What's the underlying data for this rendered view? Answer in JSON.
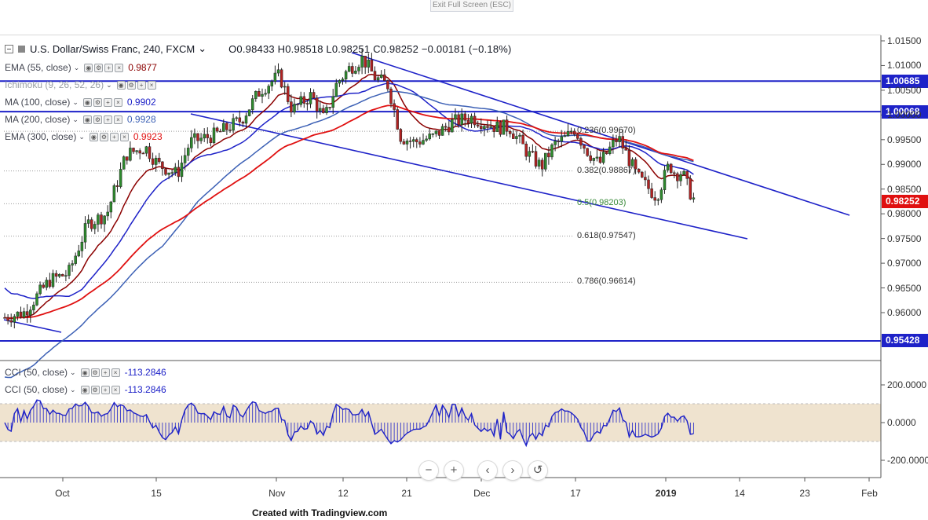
{
  "toolbar_top": {
    "exit_fullscreen": "Exit Full Screen (ESC)"
  },
  "header": {
    "title": "U.S. Dollar/Swiss Franc, 240, FXCM",
    "ohlc": "O0.98433  H0.98518  L0.98251  C0.98252  −0.00181 (−0.18%)"
  },
  "legend": [
    {
      "label": "EMA (55, close)",
      "value": "0.9877",
      "color": "#8b0000"
    },
    {
      "label": "Ichimoku (9, 26, 52, 26)",
      "value": "",
      "color": "#9aa0a6"
    },
    {
      "label": "MA (100, close)",
      "value": "0.9902",
      "color": "#1e22c8"
    },
    {
      "label": "MA (200, close)",
      "value": "0.9928",
      "color": "#3c60b5"
    },
    {
      "label": "EMA (300, close)",
      "value": "0.9923",
      "color": "#e01010"
    }
  ],
  "cci_legend": [
    {
      "label": "CCI (50, close)",
      "value": "-113.2846"
    },
    {
      "label": "CCI (50, close)",
      "value": "-113.2846"
    }
  ],
  "price_tags": [
    {
      "text": "1.00685",
      "color": "#1e22c8"
    },
    {
      "text": "1.00068",
      "color": "#1e22c8"
    },
    {
      "text": "0.98252",
      "color": "#e01010"
    },
    {
      "text": "0.95428",
      "color": "#1e22c8"
    }
  ],
  "fib_labels": [
    "0.236(0.99670)",
    "0.382(0.98867)",
    "0.5(0.98203)",
    "0.618(0.97547)",
    "0.786(0.96614)"
  ],
  "credit": "Created with Tradingview.com",
  "chart_data": {
    "type": "candlestick",
    "title": "U.S. Dollar/Swiss Franc, 240, FXCM",
    "price_axis_ticks": [
      "1.01500",
      "1.01000",
      "1.00500",
      "1.00000",
      "0.99500",
      "0.99000",
      "0.98500",
      "0.98000",
      "0.97500",
      "0.97000",
      "0.96500",
      "0.96000"
    ],
    "price_range": [
      0.954,
      1.017
    ],
    "cci_axis_ticks": [
      "200.0000",
      "0.0000",
      "-200.0000"
    ],
    "cci_range": [
      -280,
      300
    ],
    "x_ticks": [
      "Oct",
      "15",
      "Nov",
      "12",
      "21",
      "Dec",
      "17",
      "2019",
      "14",
      "23",
      "Feb"
    ],
    "close_path": [
      [
        "Sep 19",
        0.959
      ],
      [
        "Sep 22",
        0.96
      ],
      [
        "Sep 26",
        0.9665
      ],
      [
        "Sep 29",
        0.968
      ],
      [
        "Oct 2",
        0.978
      ],
      [
        "Oct 5",
        0.98
      ],
      [
        "Oct 8",
        0.992
      ],
      [
        "Oct 11",
        0.9935
      ],
      [
        "Oct 13",
        0.99
      ],
      [
        "Oct 16",
        0.988
      ],
      [
        "Oct 18",
        0.9945
      ],
      [
        "Oct 22",
        0.996
      ],
      [
        "Oct 26",
        0.999
      ],
      [
        "Oct 29",
        1.005
      ],
      [
        "Nov 1",
        1.008
      ],
      [
        "Nov 3",
        1.001
      ],
      [
        "Nov 6",
        1.004
      ],
      [
        "Nov 8",
        0.999
      ],
      [
        "Nov 10",
        1.0065
      ],
      [
        "Nov 12",
        1.0095
      ],
      [
        "Nov 14",
        1.0115
      ],
      [
        "Nov 16",
        1.0075
      ],
      [
        "Nov 18",
        1.006
      ],
      [
        "Nov 20",
        0.9955
      ],
      [
        "Nov 22",
        0.9945
      ],
      [
        "Nov 25",
        0.9955
      ],
      [
        "Nov 28",
        0.9985
      ],
      [
        "Dec 1",
        0.9995
      ],
      [
        "Dec 3",
        0.9985
      ],
      [
        "Dec 5",
        0.9975
      ],
      [
        "Dec 7",
        0.9975
      ],
      [
        "Dec 10",
        0.992
      ],
      [
        "Dec 12",
        0.9895
      ],
      [
        "Dec 14",
        0.994
      ],
      [
        "Dec 16",
        0.9955
      ],
      [
        "Dec 17",
        0.9975
      ],
      [
        "Dec 19",
        0.993
      ],
      [
        "Dec 21",
        0.99
      ],
      [
        "Dec 24",
        0.9955
      ],
      [
        "Dec 27",
        0.9875
      ],
      [
        "Dec 30",
        0.9835
      ],
      [
        "Jan 1",
        0.99
      ],
      [
        "Jan 2",
        0.988
      ],
      [
        "Jan 3",
        0.9885
      ],
      [
        "Jan 4",
        0.985
      ],
      [
        "Jan 5",
        0.98252
      ]
    ],
    "indicators": [
      "EMA 55",
      "MA 100",
      "MA 200",
      "EMA 300",
      "CCI 50"
    ],
    "fibonacci": {
      "0.236": 0.9967,
      "0.382": 0.98867,
      "0.5": 0.98203,
      "0.618": 0.97547,
      "0.786": 0.96614
    },
    "horizontal_levels": [
      1.00685,
      1.00068,
      0.95428
    ],
    "last_price": 0.98252,
    "grid": true
  }
}
